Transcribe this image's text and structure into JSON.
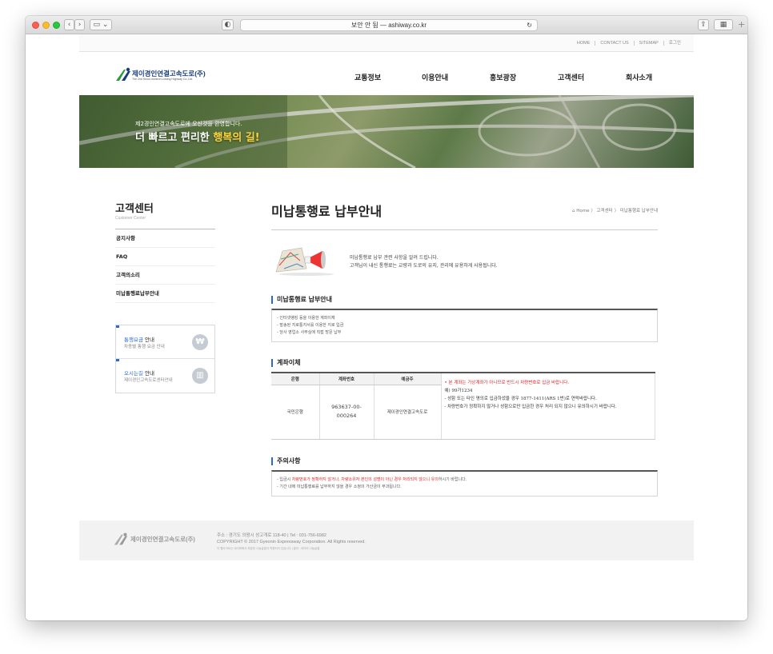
{
  "browser": {
    "url": "보안 안 됨 — ashiway.co.kr"
  },
  "util": {
    "links": [
      "HOME",
      "CONTACT US",
      "SITEMAP",
      "로그인"
    ]
  },
  "header": {
    "logo_text": "제이경인연결고속도로(주)",
    "logo_sub": "The 2nd Seoul-Incheon Linking Highway Co.,Ltd.",
    "nav": [
      "교통정보",
      "이용안내",
      "홍보광장",
      "고객센터",
      "회사소개"
    ]
  },
  "banner": {
    "line1": "제2경인연결고속도로에 오신것을 환영합니다.",
    "line2_prefix": "더 빠르고 편리한 ",
    "line2_highlight": "행복의 길!"
  },
  "sidebar": {
    "title": "고객센터",
    "subtitle": "Customer Center",
    "menu": [
      "공지사항",
      "FAQ",
      "고객의소리",
      "미납통행료납부안내"
    ],
    "quick": [
      {
        "title_hl": "통행요금",
        "title_rest": " 안내",
        "desc": "차종별 통행 요금 안내",
        "icon": "won-icon"
      },
      {
        "title_hl": "오시는길",
        "title_rest": " 안내",
        "desc": "제이경인고속도로센터안내",
        "icon": "building-icon"
      }
    ]
  },
  "main": {
    "title": "미납통행료 납부안내",
    "breadcrumb": "Home 〉 고객센터 〉 미납통행료 납부안내",
    "intro": [
      "미납통행료 납부 관련 사항을 알려 드립니다.",
      "고객님이 내신 통행료는 교량과 도로의 유지, 관리에 유용하게 사용됩니다."
    ],
    "section1": {
      "title": "미납통행료 납부안내",
      "items": [
        "- 인터넷뱅킹 등을 이용한 계좌이체",
        "- 발송된 지로통지서를 이용한 지로 입금",
        "- 당사 영업소 사무실에 직접 방문 납부"
      ]
    },
    "section2": {
      "title": "계좌이체",
      "headers": [
        "은행",
        "계좌번호",
        "예금주"
      ],
      "row": [
        "국민은행",
        "963637-00-000264",
        "제이경인연결고속도로"
      ],
      "note_red": "• 본 계좌는 가상계좌가 아니므로 반드시 차량번호로 입금 바랍니다.",
      "note_lines": [
        "예) 99가1234",
        "- 성함 또는 타인 명의로 입금하셨을 경우 1877-1411(ARS 1번)로 연락바랍니다.",
        "- 차량번호가 정확하지 않거나 성함으로만 입금한 경우 처리 되지 않으니 유의하시기 바랍니다."
      ]
    },
    "section3": {
      "title": "주의사항",
      "line1_pre": "- 입금시 ",
      "line1_red": "차량번호가 정확하지 않거나, 차량소유자 본인의 성명이 아닌 경우 처리되지 않으니 유의",
      "line1_post": "하시기 바랍니다.",
      "line2": "- 기간 내에 미납통행료를 납부하지 않을 경우 소정의 가산금이 부과됩니다."
    }
  },
  "footer": {
    "logo": "제이경인연결고속도로(주)",
    "address": "주소 : 경기도 의왕시 성고개로 118-40   |   Tel : 031-756-6982",
    "copyright": "COPYRIGHT © 2017 Gyeonin Expressway Corporation. All Rights reserved.",
    "small": "이 웹사이트는 네이버에서 제공한 나눔글꼴이 적용되어 있습니다 | 출처 : 네이버 나눔글꼴"
  }
}
